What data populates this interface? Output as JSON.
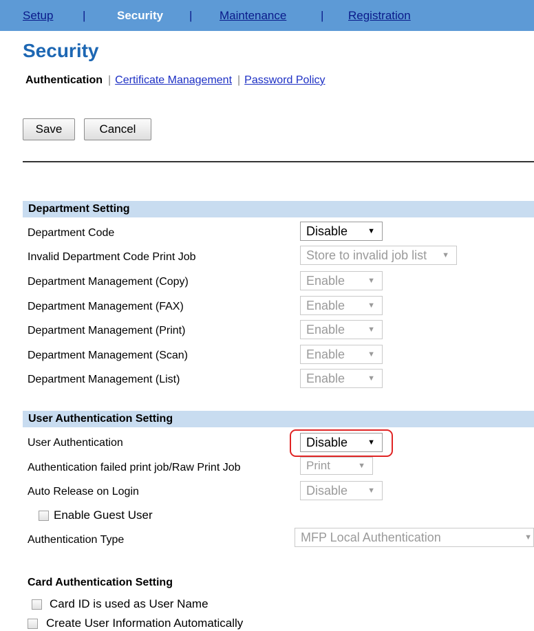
{
  "nav": {
    "items": [
      {
        "label": "Setup"
      },
      {
        "label": "Security"
      },
      {
        "label": "Maintenance"
      },
      {
        "label": "Registration"
      }
    ],
    "separator": "|"
  },
  "page_title": "Security",
  "subnav": {
    "current": "Authentication",
    "links": [
      {
        "label": "Certificate Management"
      },
      {
        "label": "Password Policy"
      }
    ],
    "separator": "|"
  },
  "buttons": {
    "save": "Save",
    "cancel": "Cancel"
  },
  "department": {
    "header": "Department Setting",
    "rows": [
      {
        "label": "Department Code",
        "value": "Disable",
        "enabled": true
      },
      {
        "label": "Invalid Department Code Print Job",
        "value": "Store to invalid job list",
        "enabled": false
      },
      {
        "label": "Department Management (Copy)",
        "value": "Enable",
        "enabled": false
      },
      {
        "label": "Department Management (FAX)",
        "value": "Enable",
        "enabled": false
      },
      {
        "label": "Department Management (Print)",
        "value": "Enable",
        "enabled": false
      },
      {
        "label": "Department Management (Scan)",
        "value": "Enable",
        "enabled": false
      },
      {
        "label": "Department Management (List)",
        "value": "Enable",
        "enabled": false
      }
    ]
  },
  "user_auth": {
    "header": "User Authentication Setting",
    "user_authentication": {
      "label": "User Authentication",
      "value": "Disable"
    },
    "failed_job": {
      "label": "Authentication failed print job/Raw Print Job",
      "value": "Print"
    },
    "auto_release": {
      "label": "Auto Release on Login",
      "value": "Disable"
    },
    "guest": {
      "label": "Enable Guest User",
      "checked": false
    },
    "auth_type": {
      "label": "Authentication Type",
      "value": "MFP Local Authentication"
    }
  },
  "card_auth": {
    "header": "Card Authentication Setting",
    "card_id": {
      "label": "Card ID is used as User Name",
      "checked": false
    },
    "create_user": {
      "label": "Create User Information Automatically",
      "checked": false
    }
  },
  "icons": {
    "dropdown": "chevron-down-icon"
  },
  "colors": {
    "nav_bg": "#5d9ad6",
    "section_bg": "#c8dcf0",
    "title": "#1d67b3",
    "highlight": "#e02424"
  }
}
